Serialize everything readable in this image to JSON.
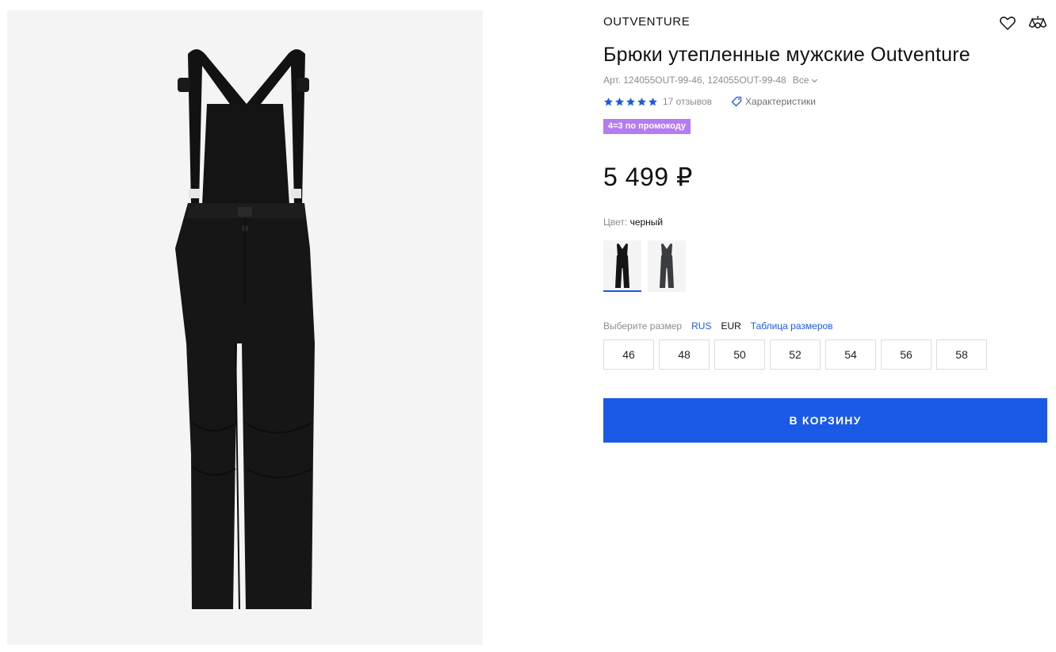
{
  "product": {
    "brand": "OUTVENTURE",
    "title": "Брюки утепленные мужские Outventure",
    "sku": "Арт. 124055OUT-99-46, 124055OUT-99-48",
    "sku_all": "Все",
    "rating": 5,
    "reviews": "17 отзывов",
    "specs_link": "Характеристики",
    "promo_badge": "4=3 по промокоду",
    "price": "5 499 ₽"
  },
  "icons": {
    "favorite": "heart-icon",
    "compare": "compare-scales-icon",
    "chevron": "chevron-down-icon",
    "tag": "tag-icon",
    "star": "star-icon"
  },
  "color": {
    "label": "Цвет:",
    "value": "черный",
    "swatches": [
      {
        "name": "черный",
        "color": "#151515",
        "selected": true
      },
      {
        "name": "серый",
        "color": "#3a3c40",
        "selected": false
      }
    ]
  },
  "sizes": {
    "label": "Выберите размер",
    "systems": [
      "RUS",
      "EUR"
    ],
    "active_system": "RUS",
    "table_link": "Таблица размеров",
    "values": [
      "46",
      "48",
      "50",
      "52",
      "54",
      "56",
      "58"
    ]
  },
  "cart_button": "В КОРЗИНУ",
  "colors": {
    "accent": "#1a5ae6",
    "promo": "#b57bf2",
    "gallery_bg": "#f4f4f4",
    "star": "#1a5ae6"
  }
}
